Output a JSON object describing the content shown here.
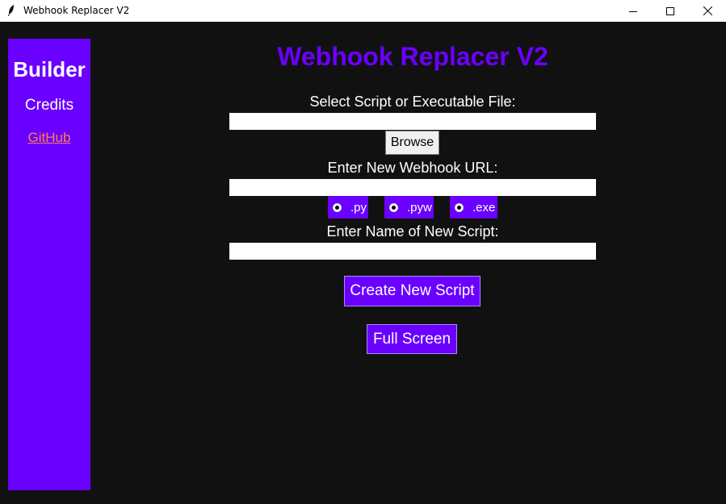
{
  "window": {
    "title": "Webhook Replacer V2",
    "icon": "feather-icon",
    "controls": [
      "minimize-icon",
      "maximize-icon",
      "close-icon"
    ]
  },
  "sidebar": {
    "builder": "Builder",
    "credits": "Credits",
    "github": "GitHub"
  },
  "main": {
    "heading": "Webhook Replacer V2",
    "file_label": "Select Script or Executable File:",
    "file_value": "",
    "browse_label": "Browse",
    "webhook_label": "Enter New Webhook URL:",
    "webhook_value": "",
    "options": [
      {
        "label": ".py",
        "selected": true
      },
      {
        "label": ".pyw",
        "selected": true
      },
      {
        "label": ".exe",
        "selected": true
      }
    ],
    "name_label": "Enter Name of New Script:",
    "name_value": "",
    "create_label": "Create New Script",
    "fullscreen_label": "Full Screen"
  },
  "colors": {
    "accent": "#6a00ff",
    "background": "#111111",
    "link": "#ff7f50",
    "text": "#ffffff"
  }
}
